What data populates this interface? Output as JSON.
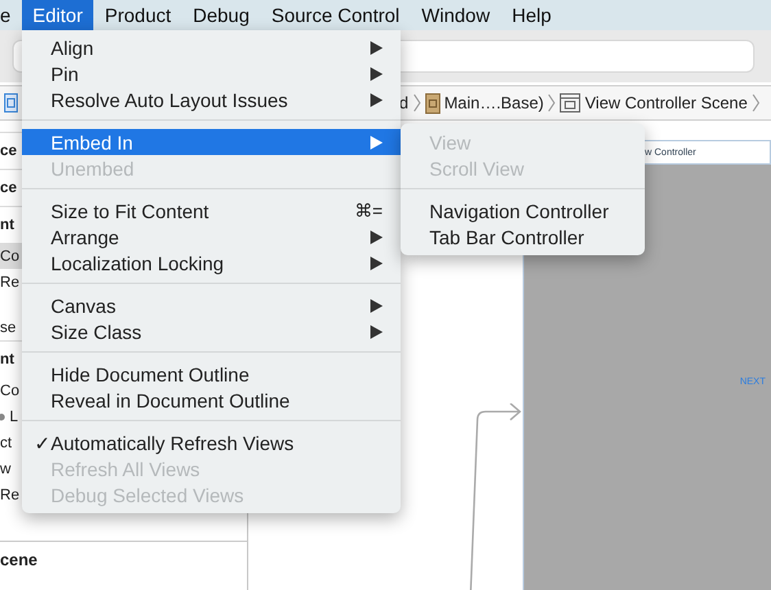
{
  "menu_bar": [
    {
      "label": "e",
      "selected": false
    },
    {
      "label": "Editor",
      "selected": true
    },
    {
      "label": "Product",
      "selected": false
    },
    {
      "label": "Debug",
      "selected": false
    },
    {
      "label": "Source Control",
      "selected": false
    },
    {
      "label": "Window",
      "selected": false
    },
    {
      "label": "Help",
      "selected": false
    }
  ],
  "breadcrumb": [
    "d",
    "Main….Base)",
    "View Controller Scene"
  ],
  "outline": [
    {
      "label": "ce",
      "kind": "header",
      "selected": false
    },
    {
      "label": "ce",
      "kind": "header",
      "selected": false
    },
    {
      "label": "nt",
      "kind": "header",
      "selected": false
    },
    {
      "label": "Co",
      "kind": "row",
      "selected": true
    },
    {
      "label": "Re",
      "kind": "row",
      "selected": false
    },
    {
      "label": "se",
      "kind": "gap",
      "selected": false
    },
    {
      "label": "nt",
      "kind": "header",
      "selected": false
    },
    {
      "label": "Co",
      "kind": "row",
      "selected": false
    },
    {
      "label": "L",
      "kind": "icon",
      "selected": false
    },
    {
      "label": "ct",
      "kind": "row",
      "selected": false
    },
    {
      "label": "w",
      "kind": "row",
      "selected": false
    },
    {
      "label": "Re",
      "kind": "row",
      "selected": false
    },
    {
      "label": "cene",
      "kind": "section",
      "selected": false
    }
  ],
  "editor_menu": [
    [
      {
        "label": "Align",
        "kind": "submenu",
        "disabled": false,
        "checked": false,
        "selected": false
      },
      {
        "label": "Pin",
        "kind": "submenu",
        "disabled": false,
        "checked": false,
        "selected": false
      },
      {
        "label": "Resolve Auto Layout Issues",
        "kind": "submenu",
        "disabled": false,
        "checked": false,
        "selected": false
      }
    ],
    [
      {
        "label": "Embed In",
        "kind": "submenu",
        "disabled": false,
        "checked": false,
        "selected": true
      },
      {
        "label": "Unembed",
        "kind": "command",
        "disabled": true,
        "checked": false,
        "selected": false
      }
    ],
    [
      {
        "label": "Size to Fit Content",
        "kind": "command",
        "shortcut": "⌘=",
        "disabled": false,
        "checked": false,
        "selected": false
      },
      {
        "label": "Arrange",
        "kind": "submenu",
        "disabled": false,
        "checked": false,
        "selected": false
      },
      {
        "label": "Localization Locking",
        "kind": "submenu",
        "disabled": false,
        "checked": false,
        "selected": false
      }
    ],
    [
      {
        "label": "Canvas",
        "kind": "submenu",
        "disabled": false,
        "checked": false,
        "selected": false
      },
      {
        "label": "Size Class",
        "kind": "submenu",
        "disabled": false,
        "checked": false,
        "selected": false
      }
    ],
    [
      {
        "label": "Hide Document Outline",
        "kind": "command",
        "disabled": false,
        "checked": false,
        "selected": false
      },
      {
        "label": "Reveal in Document Outline",
        "kind": "command",
        "disabled": false,
        "checked": false,
        "selected": false
      }
    ],
    [
      {
        "label": "Automatically Refresh Views",
        "kind": "command",
        "disabled": false,
        "checked": true,
        "selected": false
      },
      {
        "label": "Refresh All Views",
        "kind": "command",
        "disabled": true,
        "checked": false,
        "selected": false
      },
      {
        "label": "Debug Selected Views",
        "kind": "command",
        "disabled": true,
        "checked": false,
        "selected": false
      }
    ]
  ],
  "check_mark": "✓",
  "embed_submenu": [
    [
      {
        "label": "View",
        "disabled": true
      },
      {
        "label": "Scroll View",
        "disabled": true
      }
    ],
    [
      {
        "label": "Navigation Controller",
        "disabled": false
      },
      {
        "label": "Tab Bar Controller",
        "disabled": false
      }
    ]
  ],
  "canvas": {
    "scene_title": "w Controller",
    "next_button": "NEXT"
  }
}
